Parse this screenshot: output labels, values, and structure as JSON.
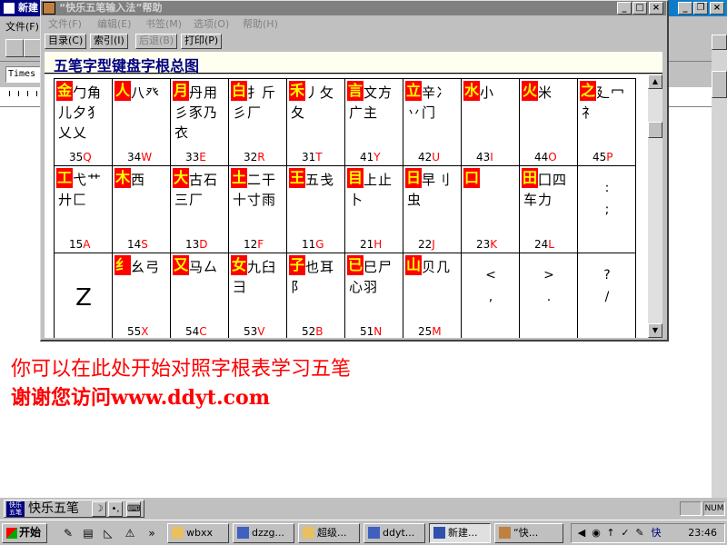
{
  "bg_window": {
    "title": "新建",
    "menu_label": "文件(F)",
    "font_value": "Times",
    "note_line1": "你可以在此处开始对照字根表学习五笔",
    "note_line2": "谢谢您访问www.ddyt.com"
  },
  "help_window": {
    "title": "“快乐五笔输入法”帮助",
    "menu": [
      "文件(F)",
      "编辑(E)",
      "书签(M)",
      "选项(O)",
      "帮助(H)"
    ],
    "buttons": [
      "目录(C)",
      "索引(I)",
      "后退(B)",
      "打印(P)"
    ],
    "heading": "五笔字型键盘字根总图",
    "keys": [
      [
        {
          "main": "金",
          "roots": "钅勹角儿夕犭乂乂",
          "num": "35",
          "letter": "Q"
        },
        {
          "main": "人",
          "roots": "亻八癶",
          "num": "34",
          "letter": "W"
        },
        {
          "main": "月",
          "roots": "目丹用彡豕乃衣",
          "num": "33",
          "letter": "E"
        },
        {
          "main": "白",
          "roots": "手扌斤彡厂",
          "num": "32",
          "letter": "R"
        },
        {
          "main": "禾",
          "roots": "竹丿攵夂",
          "num": "31",
          "letter": "T"
        },
        {
          "main": "言",
          "roots": "讠文方广主",
          "num": "41",
          "letter": "Y"
        },
        {
          "main": "立",
          "roots": "六辛冫丷门",
          "num": "42",
          "letter": "U"
        },
        {
          "main": "水",
          "roots": "氵小",
          "num": "43",
          "letter": "I"
        },
        {
          "main": "火",
          "roots": "灬米",
          "num": "44",
          "letter": "O"
        },
        {
          "main": "之",
          "roots": "辶廴冖礻",
          "num": "45",
          "letter": "P"
        }
      ],
      [
        {
          "main": "工",
          "roots": "戈弋艹廾匚",
          "num": "15",
          "letter": "A"
        },
        {
          "main": "木",
          "roots": "丁西",
          "num": "14",
          "letter": "S"
        },
        {
          "main": "大",
          "roots": "犬古石三厂",
          "num": "13",
          "letter": "D"
        },
        {
          "main": "土",
          "roots": "士二干十寸雨",
          "num": "12",
          "letter": "F"
        },
        {
          "main": "王",
          "roots": "一五戋",
          "num": "11",
          "letter": "G"
        },
        {
          "main": "目",
          "roots": "丨上止卜",
          "num": "21",
          "letter": "H"
        },
        {
          "main": "日",
          "roots": "曰早刂虫",
          "num": "22",
          "letter": "J"
        },
        {
          "main": "口",
          "roots": "川",
          "num": "23",
          "letter": "K"
        },
        {
          "main": "田",
          "roots": "甲囗四车力",
          "num": "24",
          "letter": "L"
        },
        {
          "punct": ":\n;"
        }
      ],
      [
        {
          "big": "Z"
        },
        {
          "main": "纟",
          "roots": "匕幺弓",
          "num": "55",
          "letter": "X"
        },
        {
          "main": "又",
          "roots": "巴马厶",
          "num": "54",
          "letter": "C"
        },
        {
          "main": "女",
          "roots": "刀九臼彐",
          "num": "53",
          "letter": "V"
        },
        {
          "main": "子",
          "roots": "了也耳阝",
          "num": "52",
          "letter": "B"
        },
        {
          "main": "已",
          "roots": "己巳尸心羽",
          "num": "51",
          "letter": "N"
        },
        {
          "main": "山",
          "roots": "由贝几",
          "num": "25",
          "letter": "M"
        },
        {
          "punct": "<\n,"
        },
        {
          "punct": ">\n."
        },
        {
          "punct": "?\n/"
        }
      ]
    ]
  },
  "status_bar": {
    "ime_logo": "快乐五笔",
    "ime_name": "快乐五笔",
    "num_indicator": "NUM"
  },
  "taskbar": {
    "start_label": "开始",
    "tasks": [
      "wbxx",
      "dzzg...",
      "超级...",
      "ddyt...",
      "新建...",
      "“快..."
    ],
    "clock": "23:46"
  }
}
